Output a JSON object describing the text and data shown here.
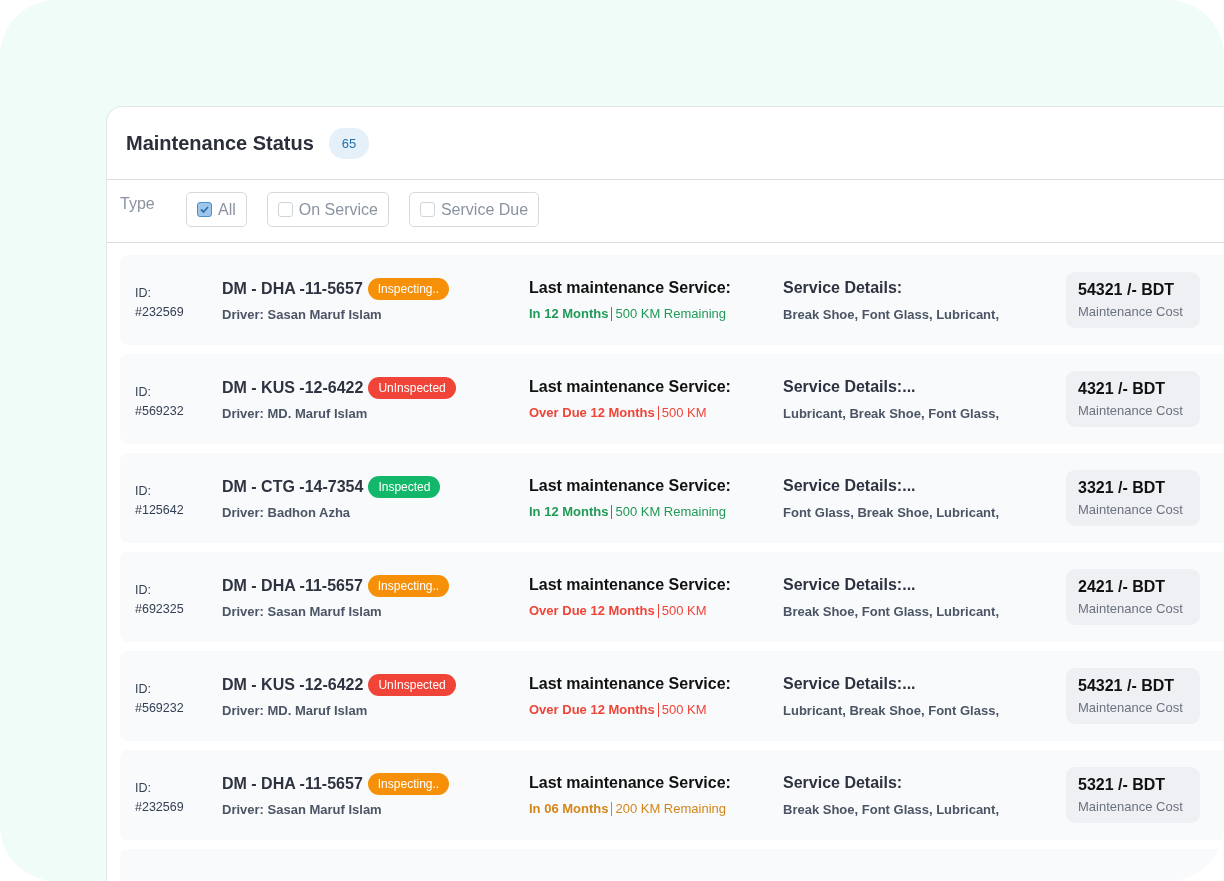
{
  "title": "Maintenance Status",
  "count": "65",
  "filter": {
    "label": "Type",
    "options": [
      {
        "label": "All",
        "checked": true
      },
      {
        "label": "On Service",
        "checked": false
      },
      {
        "label": "Service Due",
        "checked": false
      }
    ]
  },
  "rows": [
    {
      "id_label": "ID:",
      "id": "#232569",
      "plate": "DM - DHA -11-5657",
      "badge": {
        "label": "Inspecting..",
        "color": "#f79009"
      },
      "driver": "Driver: Sasan Maruf Islam",
      "last_label": "Last maintenance Service:",
      "kind": "ok",
      "due": "In 12 Months",
      "km": "500 KM Remaining",
      "details_label": "Service Details:",
      "details": "Break Shoe, Font Glass, Lubricant,",
      "cost": "54321 /- BDT",
      "cost_label": "Maintenance Cost"
    },
    {
      "id_label": "ID:",
      "id": "#569232",
      "plate": "DM - KUS -12-6422",
      "badge": {
        "label": "UnInspected",
        "color": "#f04438"
      },
      "driver": "Driver: MD. Maruf Islam",
      "last_label": "Last maintenance Service:",
      "kind": "overdue",
      "due": "Over Due 12 Months",
      "km": "500 KM",
      "details_label": "Service Details:...",
      "details": "Lubricant, Break Shoe, Font Glass,",
      "cost": "4321 /- BDT",
      "cost_label": "Maintenance Cost"
    },
    {
      "id_label": "ID:",
      "id": "#125642",
      "plate": "DM - CTG -14-7354",
      "badge": {
        "label": "Inspected",
        "color": "#12b76a"
      },
      "driver": "Driver: Badhon Azha",
      "last_label": "Last maintenance Service:",
      "kind": "ok",
      "due": "In 12 Months",
      "km": "500 KM Remaining",
      "details_label": "Service Details:...",
      "details": "Font Glass, Break Shoe, Lubricant,",
      "cost": "3321 /- BDT",
      "cost_label": "Maintenance Cost"
    },
    {
      "id_label": "ID:",
      "id": "#692325",
      "plate": "DM - DHA -11-5657",
      "badge": {
        "label": "Inspecting..",
        "color": "#f79009"
      },
      "driver": "Driver: Sasan Maruf Islam",
      "last_label": "Last maintenance Service:",
      "kind": "overdue",
      "due": "Over Due 12 Months",
      "km": "500 KM",
      "details_label": "Service Details:...",
      "details": "Break Shoe, Font Glass, Lubricant,",
      "cost": "2421 /- BDT",
      "cost_label": "Maintenance Cost"
    },
    {
      "id_label": "ID:",
      "id": "#569232",
      "plate": "DM - KUS -12-6422",
      "badge": {
        "label": "UnInspected",
        "color": "#f04438"
      },
      "driver": "Driver: MD. Maruf Islam",
      "last_label": "Last maintenance Service:",
      "kind": "overdue",
      "due": "Over Due 12 Months",
      "km": "500 KM",
      "details_label": "Service Details:...",
      "details": "Lubricant, Break Shoe, Font Glass,",
      "cost": "54321 /- BDT",
      "cost_label": "Maintenance Cost"
    },
    {
      "id_label": "ID:",
      "id": "#232569",
      "plate": "DM - DHA -11-5657",
      "badge": {
        "label": "Inspecting..",
        "color": "#f79009"
      },
      "driver": "Driver: Sasan Maruf Islam",
      "last_label": "Last maintenance Service:",
      "kind": "soon",
      "due": "In 06 Months",
      "km": "200 KM Remaining",
      "details_label": "Service Details:",
      "details": "Break Shoe, Font Glass, Lubricant,",
      "cost": "5321 /- BDT",
      "cost_label": "Maintenance Cost"
    },
    {
      "kind": "partial"
    }
  ]
}
